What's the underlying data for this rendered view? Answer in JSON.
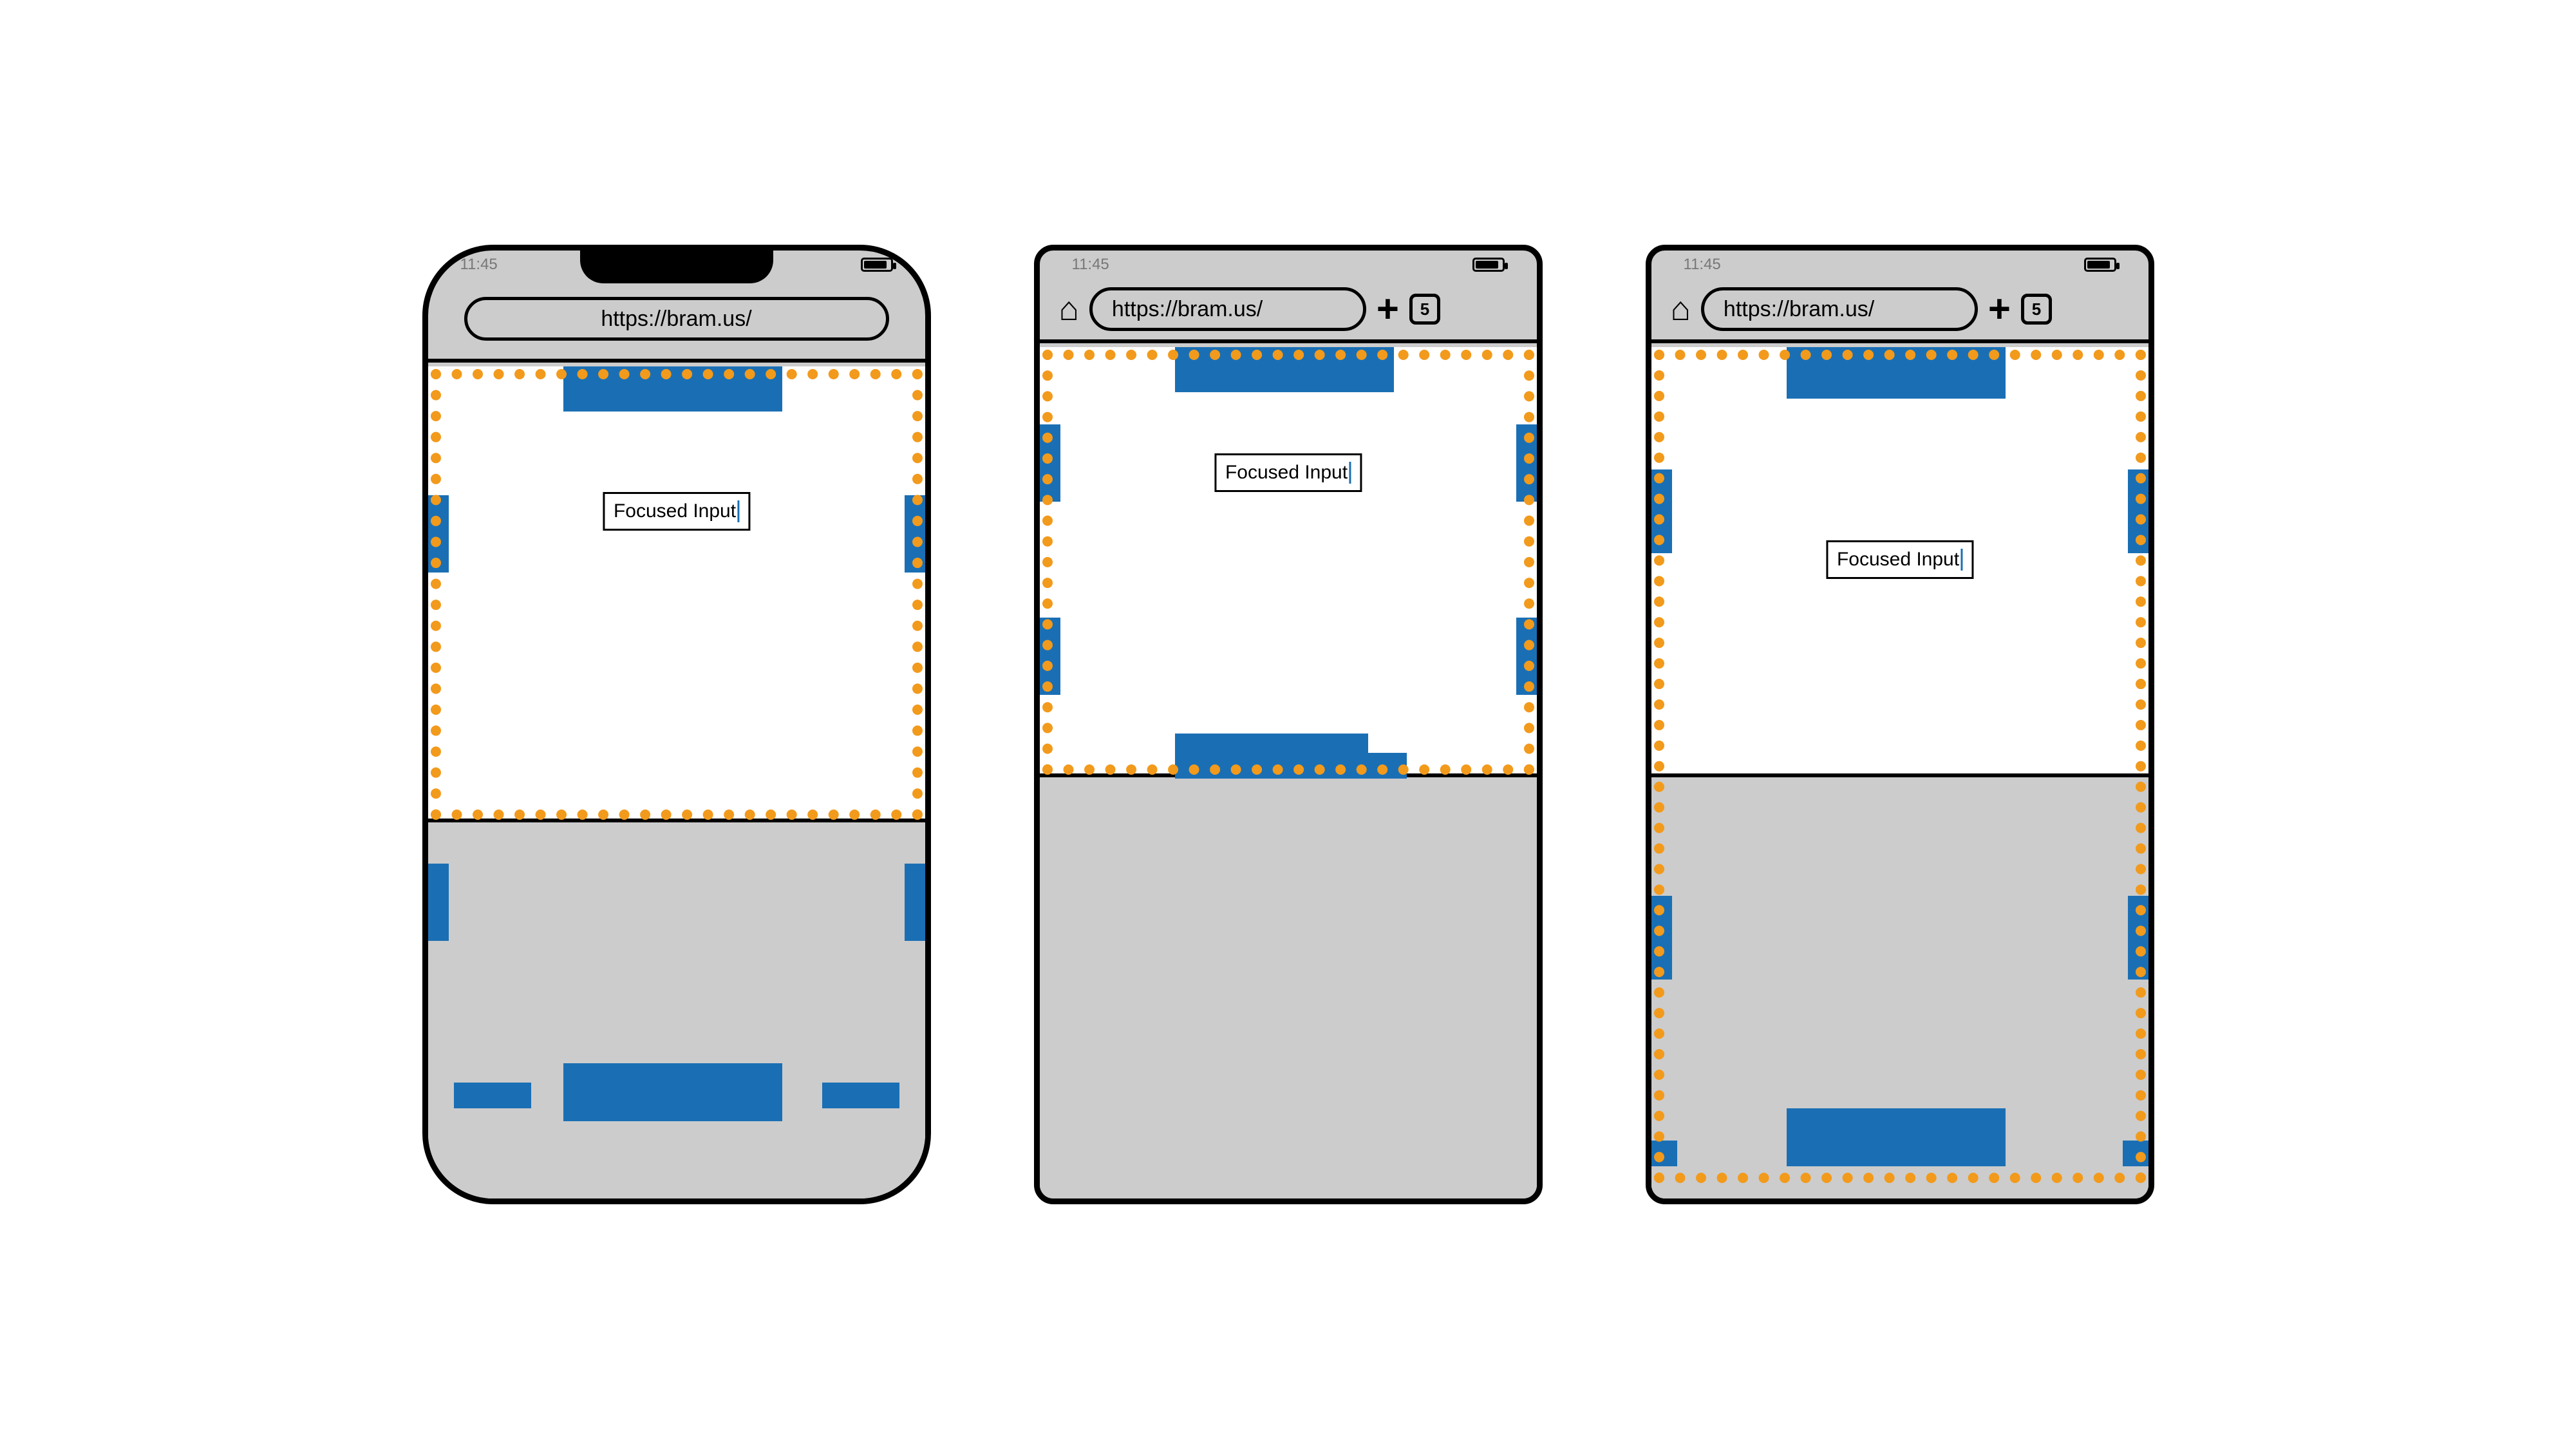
{
  "status": {
    "time": "11:45"
  },
  "browser": {
    "url": "https://bram.us/",
    "tab_count": "5"
  },
  "input": {
    "value": "Focused Input"
  },
  "colors": {
    "blue": "#1a6fb4",
    "orange": "#f29a1c",
    "grey": "#cccccc"
  },
  "phones": [
    {
      "id": "phone-1",
      "style": "notch",
      "dotted_follows_keyboard": false
    },
    {
      "id": "phone-2",
      "style": "rect",
      "dotted_follows_keyboard": true
    },
    {
      "id": "phone-3",
      "style": "rect",
      "dotted_follows_keyboard": false
    }
  ]
}
